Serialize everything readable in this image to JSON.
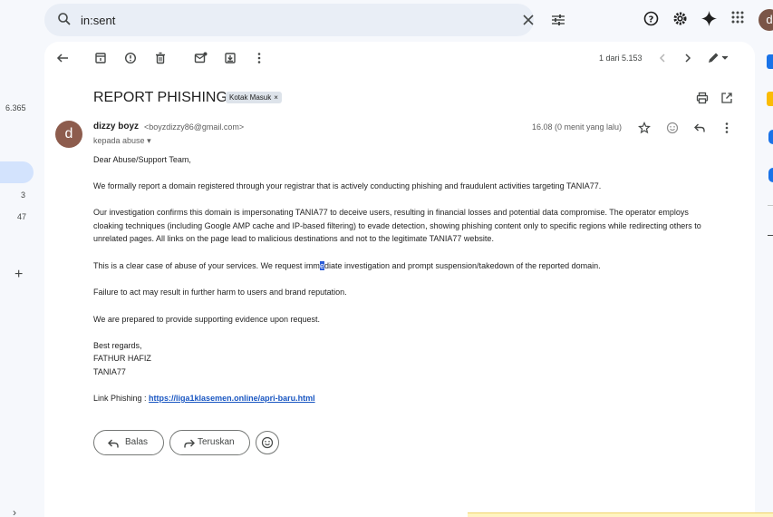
{
  "search": {
    "query": "in:sent"
  },
  "left_rail": {
    "counts": [
      "6.365",
      "3",
      "47"
    ]
  },
  "top_icons": [
    "help-icon",
    "settings-icon",
    "gemini-icon",
    "apps-icon"
  ],
  "account": {
    "initial": "d"
  },
  "toolbar": {
    "icons": [
      "back-arrow-icon",
      "archive-icon",
      "report-spam-icon",
      "delete-icon",
      "mark-unread-icon",
      "move-to-icon",
      "more-vert-icon"
    ],
    "pager": "1 dari 5.153"
  },
  "message": {
    "subject": "REPORT PHISHING",
    "label": "Kotak Masuk",
    "label_close": "×",
    "sender_initial": "d",
    "sender_name": "dizzy boyz",
    "sender_email": "<boyzdizzy86@gmail.com>",
    "to_line": "kepada abuse",
    "timestamp": "16.08 (0 menit yang lalu)",
    "greeting": "Dear Abuse/Support Team,",
    "p1": "We formally report a domain registered through your registrar that is actively conducting phishing and fraudulent activities targeting TANIA77.",
    "p2": "Our investigation confirms this domain is impersonating TANIA77 to deceive users, resulting in financial losses and potential data compromise. The operator employs cloaking techniques (including Google AMP cache and IP-based filtering) to evade detection, showing phishing content only to specific regions while redirecting others to unrelated pages. All links on the page lead to malicious destinations and not to the legitimate TANIA77 website.",
    "p3_before": "This is a clear case of abuse of your services. We request imm",
    "p3_highlight": "e",
    "p3_after": "diate investigation and prompt suspension/takedown of the reported domain.",
    "p4": "Failure to act may result in further harm to users and brand reputation.",
    "p5": "We are prepared to provide supporting evidence upon request.",
    "sign_1": "Best regards,",
    "sign_2": "FATHUR HAFIZ",
    "sign_3": "TANIA77",
    "link_label": "Link Phishing : ",
    "link_url": "https://liga1klasemen.online/apri-baru.html"
  },
  "actions": {
    "reply": "Balas",
    "forward": "Teruskan"
  },
  "colors": {
    "accent": "#0b57d0",
    "avatar": "#8d5c4d",
    "link": "#1a57c2"
  }
}
